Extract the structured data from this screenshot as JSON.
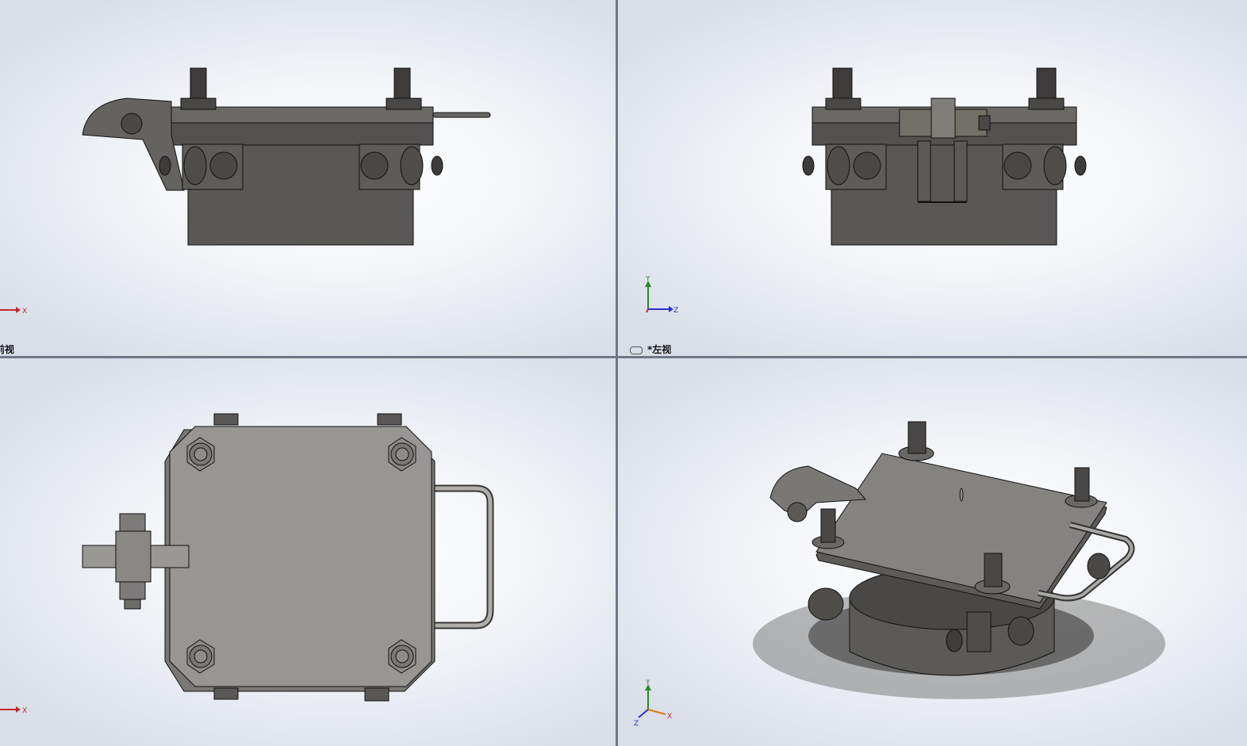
{
  "viewports": {
    "front": {
      "label": "前视",
      "axes": [
        "X"
      ]
    },
    "left": {
      "label": "*左视",
      "axes": [
        "Y",
        "Z"
      ]
    },
    "top": {
      "label": "",
      "axes": [
        "X"
      ]
    },
    "iso": {
      "label": "",
      "axes": [
        "Y",
        "X",
        "Z"
      ]
    }
  },
  "colors": {
    "metal_dark": "#5d5b58",
    "metal_mid": "#6e6c69",
    "metal_light": "#8b8986",
    "edge": "#1a1a1a",
    "top_plate": "#9a9894",
    "axis_x": "#c0282d",
    "axis_y": "#2a8a2a",
    "axis_z": "#2a33c8"
  }
}
